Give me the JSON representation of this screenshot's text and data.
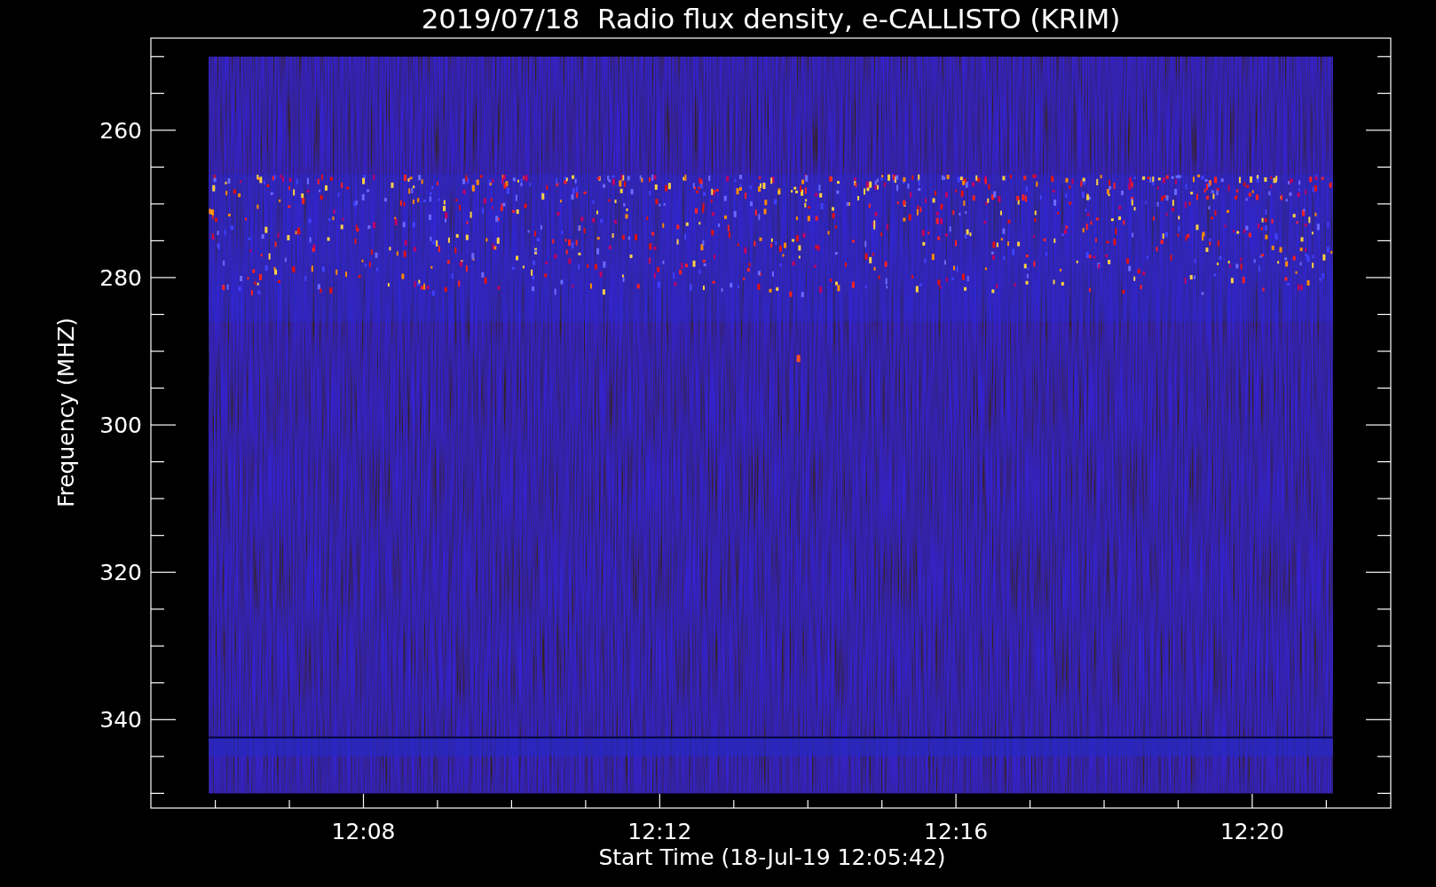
{
  "plot": {
    "title": "2019/07/18  Radio flux density, e-CALLISTO (KRIM)",
    "x_axis": {
      "label": "Start Time (18-Jul-19 12:05:42)",
      "ticks": [
        "12:08",
        "12:12",
        "12:16",
        "12:20"
      ]
    },
    "y_axis": {
      "label": "Frequency (MHZ)",
      "ticks": [
        "260",
        "280",
        "300",
        "320",
        "340"
      ]
    }
  }
}
